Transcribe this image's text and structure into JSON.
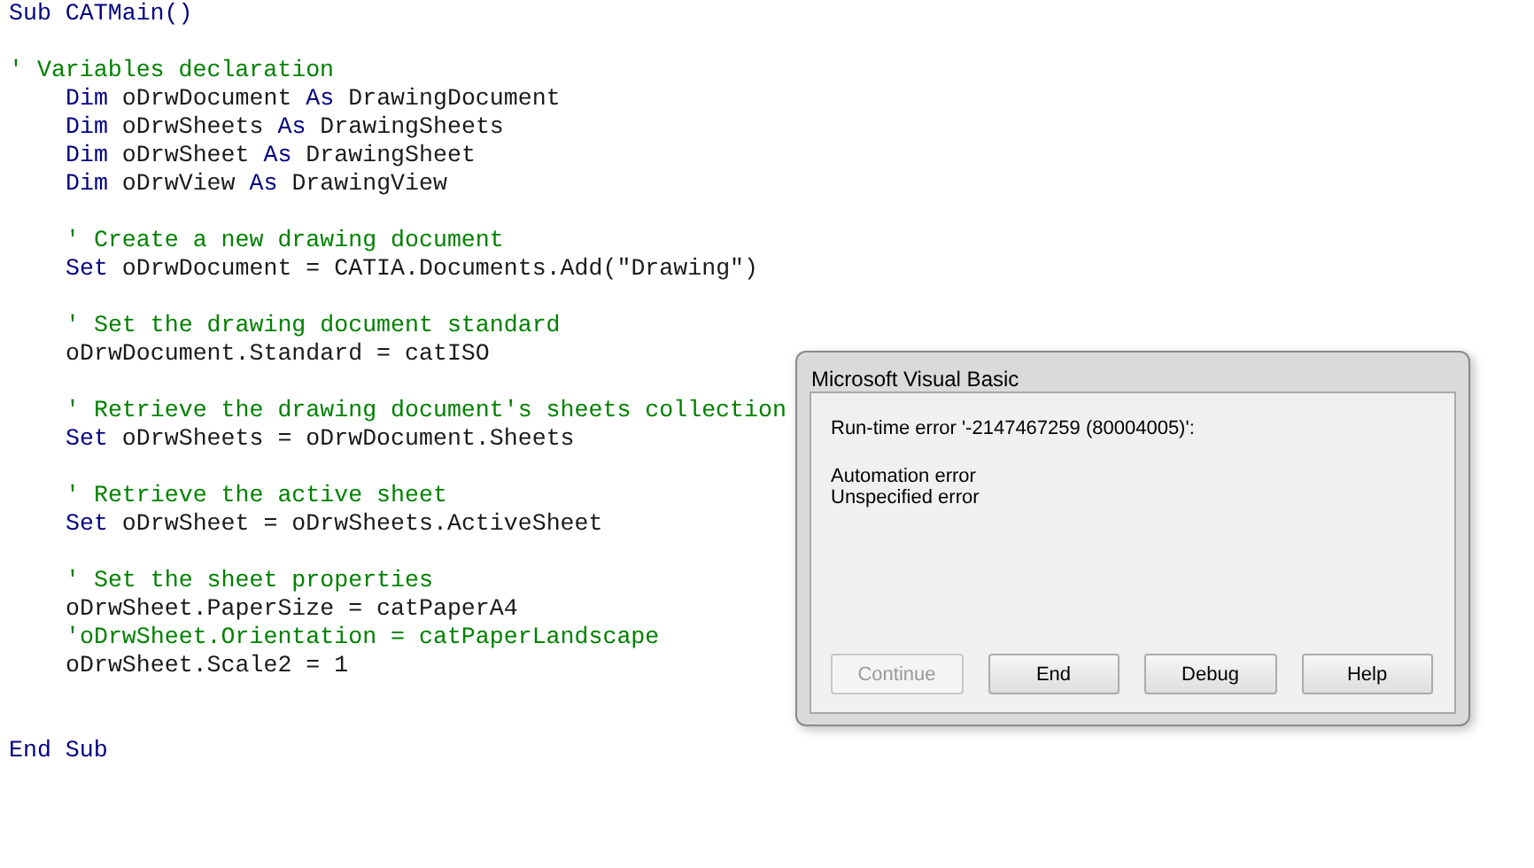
{
  "code": {
    "lines": [
      {
        "kind": "code",
        "segments": [
          {
            "kind": "keyword",
            "text": "Sub CATMain()"
          }
        ]
      },
      {
        "kind": "blank"
      },
      {
        "kind": "code",
        "segments": [
          {
            "kind": "comment",
            "text": "' Variables declaration"
          }
        ]
      },
      {
        "kind": "indented",
        "segments": [
          {
            "kind": "keyword",
            "text": "Dim"
          },
          {
            "kind": "plain",
            "text": " oDrwDocument "
          },
          {
            "kind": "keyword",
            "text": "As"
          },
          {
            "kind": "plain",
            "text": " DrawingDocument"
          }
        ]
      },
      {
        "kind": "indented",
        "segments": [
          {
            "kind": "keyword",
            "text": "Dim"
          },
          {
            "kind": "plain",
            "text": " oDrwSheets "
          },
          {
            "kind": "keyword",
            "text": "As"
          },
          {
            "kind": "plain",
            "text": " DrawingSheets"
          }
        ]
      },
      {
        "kind": "indented",
        "segments": [
          {
            "kind": "keyword",
            "text": "Dim"
          },
          {
            "kind": "plain",
            "text": " oDrwSheet "
          },
          {
            "kind": "keyword",
            "text": "As"
          },
          {
            "kind": "plain",
            "text": " DrawingSheet"
          }
        ]
      },
      {
        "kind": "indented",
        "segments": [
          {
            "kind": "keyword",
            "text": "Dim"
          },
          {
            "kind": "plain",
            "text": " oDrwView "
          },
          {
            "kind": "keyword",
            "text": "As"
          },
          {
            "kind": "plain",
            "text": " DrawingView"
          }
        ]
      },
      {
        "kind": "blank"
      },
      {
        "kind": "indented",
        "segments": [
          {
            "kind": "comment",
            "text": "' Create a new drawing document"
          }
        ]
      },
      {
        "kind": "indented",
        "segments": [
          {
            "kind": "keyword",
            "text": "Set"
          },
          {
            "kind": "plain",
            "text": " oDrwDocument = CATIA.Documents.Add(\"Drawing\")"
          }
        ]
      },
      {
        "kind": "blank"
      },
      {
        "kind": "indented",
        "segments": [
          {
            "kind": "comment",
            "text": "' Set the drawing document standard"
          }
        ]
      },
      {
        "kind": "indented",
        "segments": [
          {
            "kind": "plain",
            "text": "oDrwDocument.Standard = catISO"
          }
        ]
      },
      {
        "kind": "blank"
      },
      {
        "kind": "indented",
        "segments": [
          {
            "kind": "comment",
            "text": "' Retrieve the drawing document's sheets collection"
          }
        ]
      },
      {
        "kind": "indented",
        "segments": [
          {
            "kind": "keyword",
            "text": "Set"
          },
          {
            "kind": "plain",
            "text": " oDrwSheets = oDrwDocument.Sheets"
          }
        ]
      },
      {
        "kind": "blank"
      },
      {
        "kind": "indented",
        "segments": [
          {
            "kind": "comment",
            "text": "' Retrieve the active sheet"
          }
        ]
      },
      {
        "kind": "indented",
        "segments": [
          {
            "kind": "keyword",
            "text": "Set"
          },
          {
            "kind": "plain",
            "text": " oDrwSheet = oDrwSheets.ActiveSheet"
          }
        ]
      },
      {
        "kind": "blank"
      },
      {
        "kind": "indented",
        "segments": [
          {
            "kind": "comment",
            "text": "' Set the sheet properties"
          }
        ]
      },
      {
        "kind": "indented",
        "segments": [
          {
            "kind": "plain",
            "text": "oDrwSheet.PaperSize = catPaperA4"
          }
        ]
      },
      {
        "kind": "indented",
        "segments": [
          {
            "kind": "comment",
            "text": "'oDrwSheet.Orientation = catPaperLandscape"
          }
        ]
      },
      {
        "kind": "indented",
        "segments": [
          {
            "kind": "plain",
            "text": "oDrwSheet.Scale2 = 1"
          }
        ]
      },
      {
        "kind": "blank"
      },
      {
        "kind": "blank"
      },
      {
        "kind": "code",
        "segments": [
          {
            "kind": "keyword",
            "text": "End Sub"
          }
        ]
      }
    ]
  },
  "dialog": {
    "title": "Microsoft Visual Basic",
    "message": "Run-time error '-2147467259 (80004005)':",
    "details": [
      "Automation error",
      "Unspecified error"
    ],
    "buttons": [
      {
        "label": "Continue",
        "disabled": true
      },
      {
        "label": "End",
        "disabled": false
      },
      {
        "label": "Debug",
        "disabled": false
      },
      {
        "label": "Help",
        "disabled": false
      }
    ]
  }
}
